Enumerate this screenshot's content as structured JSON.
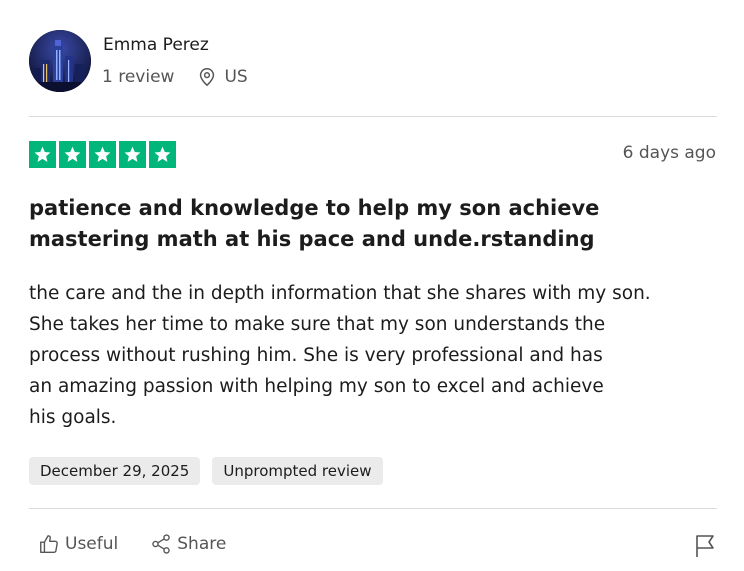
{
  "reviewer": {
    "name": "Emma Perez",
    "review_count": "1 review",
    "location": "US",
    "avatar_icon": "city-night-avatar"
  },
  "review": {
    "rating": 5,
    "rating_max": 5,
    "date_ago": "6 days ago",
    "title": "patience and knowledge to help my son achieve mastering math at his pace and unde.rstanding",
    "body": "the care and the in depth information that she shares with my son. She takes her time to make sure that my son understands the process without rushing him. She is very professional and has an amazing passion with helping my son to excel and achieve his goals.",
    "tags": [
      "December 29, 2025",
      "Unprompted review"
    ]
  },
  "actions": {
    "useful_label": "Useful",
    "share_label": "Share",
    "useful_icon": "thumbs-up-icon",
    "share_icon": "share-icon",
    "flag_icon": "flag-icon"
  },
  "colors": {
    "star_green": "#00b67a",
    "text": "#1c1c1c",
    "muted": "#555555",
    "tag_bg": "#ebebeb"
  }
}
